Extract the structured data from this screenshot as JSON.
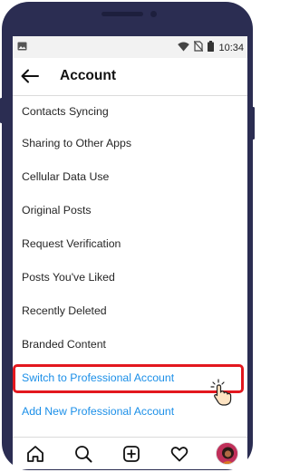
{
  "status_bar": {
    "time": "10:34",
    "icons": [
      "image-icon",
      "wifi-icon",
      "no-sim-icon",
      "battery-icon"
    ]
  },
  "header": {
    "title": "Account",
    "back_icon": "arrow-left-icon"
  },
  "menu": {
    "items": [
      "Contacts Syncing",
      "Sharing to Other Apps",
      "Cellular Data Use",
      "Original Posts",
      "Request Verification",
      "Posts You've Liked",
      "Recently Deleted",
      "Branded Content"
    ],
    "links": [
      "Switch to Professional Account",
      "Add New Professional Account"
    ]
  },
  "tab_bar": {
    "icons": [
      "home-icon",
      "search-icon",
      "new-post-icon",
      "activity-heart-icon",
      "profile-avatar"
    ]
  },
  "colors": {
    "phone_frame": "#2b2d52",
    "link_blue": "#1b8fe8",
    "highlight_red": "#e3171e",
    "status_bar_bg": "#f2f2f2",
    "text": "#262626"
  }
}
